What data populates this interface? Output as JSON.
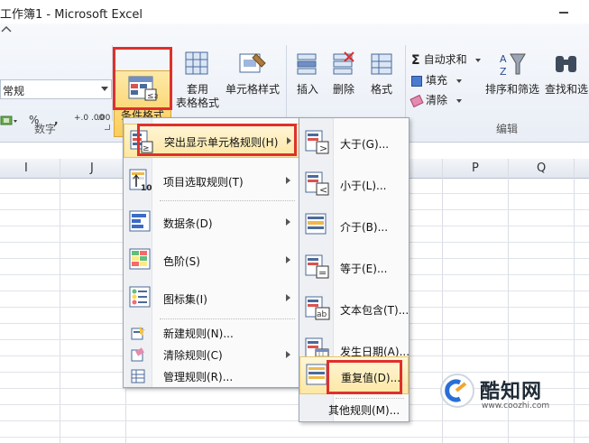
{
  "window": {
    "title": "工作簿1 - Microsoft Excel"
  },
  "ribbon": {
    "number_format_value": "常规",
    "percent": "%",
    "comma": ",",
    "dec_increase": "+.0 .00",
    "dec_decrease": ".00 +.0",
    "group_number": "数字",
    "group_edit": "编辑",
    "conditional_format": "条件格式",
    "table_format_line1": "套用",
    "table_format_line2": "表格格式",
    "cell_style": "单元格样式",
    "insert": "插入",
    "delete": "删除",
    "format": "格式",
    "autosum": "自动求和",
    "fill": "填充",
    "clear": "清除",
    "sort_filter": "排序和筛选",
    "find_select": "查找和选"
  },
  "columns": [
    "I",
    "J",
    "P",
    "Q"
  ],
  "menu": {
    "items": [
      {
        "label": "突出显示单元格规则(H)",
        "has_sub": true
      },
      {
        "label": "项目选取规则(T)",
        "has_sub": true
      },
      {
        "label": "数据条(D)",
        "has_sub": true
      },
      {
        "label": "色阶(S)",
        "has_sub": true
      },
      {
        "label": "图标集(I)",
        "has_sub": true
      },
      {
        "label": "新建规则(N)..."
      },
      {
        "label": "清除规则(C)",
        "has_sub": true
      },
      {
        "label": "管理规则(R)..."
      }
    ]
  },
  "submenu": {
    "items": [
      {
        "label": "大于(G)..."
      },
      {
        "label": "小于(L)..."
      },
      {
        "label": "介于(B)..."
      },
      {
        "label": "等于(E)..."
      },
      {
        "label": "文本包含(T)..."
      },
      {
        "label": "发生日期(A)..."
      },
      {
        "label": "重复值(D)..."
      },
      {
        "label": "其他规则(M)..."
      }
    ]
  },
  "watermark": {
    "name": "酷知网",
    "url": "www.coozhi.com"
  },
  "colors": {
    "highlight_red": "#e0302b",
    "menu_hover": "#fde7a4",
    "ribbon_bg": "#e9eef6"
  }
}
